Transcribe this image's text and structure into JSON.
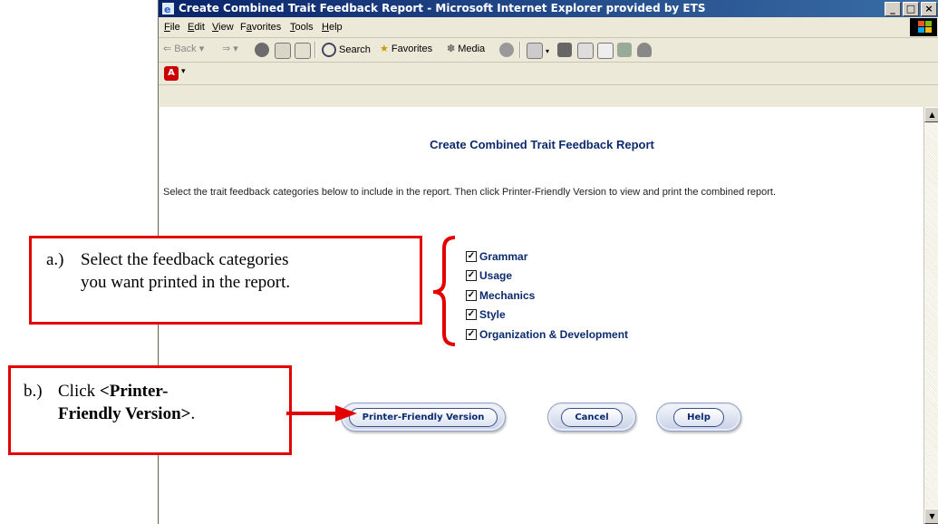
{
  "window": {
    "title": "Create Combined Trait Feedback Report - Microsoft Internet Explorer provided by ETS",
    "controls": [
      "_",
      "□",
      "×"
    ]
  },
  "menu": {
    "items": [
      {
        "key": "F",
        "rest": "ile"
      },
      {
        "key": "E",
        "rest": "dit"
      },
      {
        "key": "V",
        "rest": "iew"
      },
      {
        "pre": "F",
        "key": "a",
        "rest": "vorites"
      },
      {
        "key": "T",
        "rest": "ools"
      },
      {
        "key": "H",
        "rest": "elp"
      }
    ]
  },
  "toolbar": {
    "back": "Back",
    "search": "Search",
    "favorites": "Favorites",
    "media": "Media"
  },
  "page": {
    "title": "Create Combined Trait Feedback Report",
    "instructions": "Select the trait feedback categories below to include in the report. Then click Printer-Friendly Version to view and print the combined report.",
    "categories": [
      {
        "label": "Grammar",
        "checked": true
      },
      {
        "label": "Usage",
        "checked": true
      },
      {
        "label": "Mechanics",
        "checked": true
      },
      {
        "label": "Style",
        "checked": true
      },
      {
        "label": "Organization & Development",
        "checked": true
      }
    ],
    "buttons": {
      "printer_friendly": "Printer-Friendly Version",
      "cancel": "Cancel",
      "help": "Help"
    }
  },
  "callouts": {
    "a": {
      "marker": "a.)",
      "line1": "Select the feedback categories",
      "line2": "you want printed in the report."
    },
    "b": {
      "marker": "b.)",
      "line1_prefix": "Click ",
      "line1_bold": "<Printer-",
      "line2_bold": "Friendly Version>",
      "line2_suffix": "."
    }
  },
  "colors": {
    "callout_border": "#e30000",
    "title_text": "#0c2a6e",
    "titlebar": "#0a246a"
  }
}
